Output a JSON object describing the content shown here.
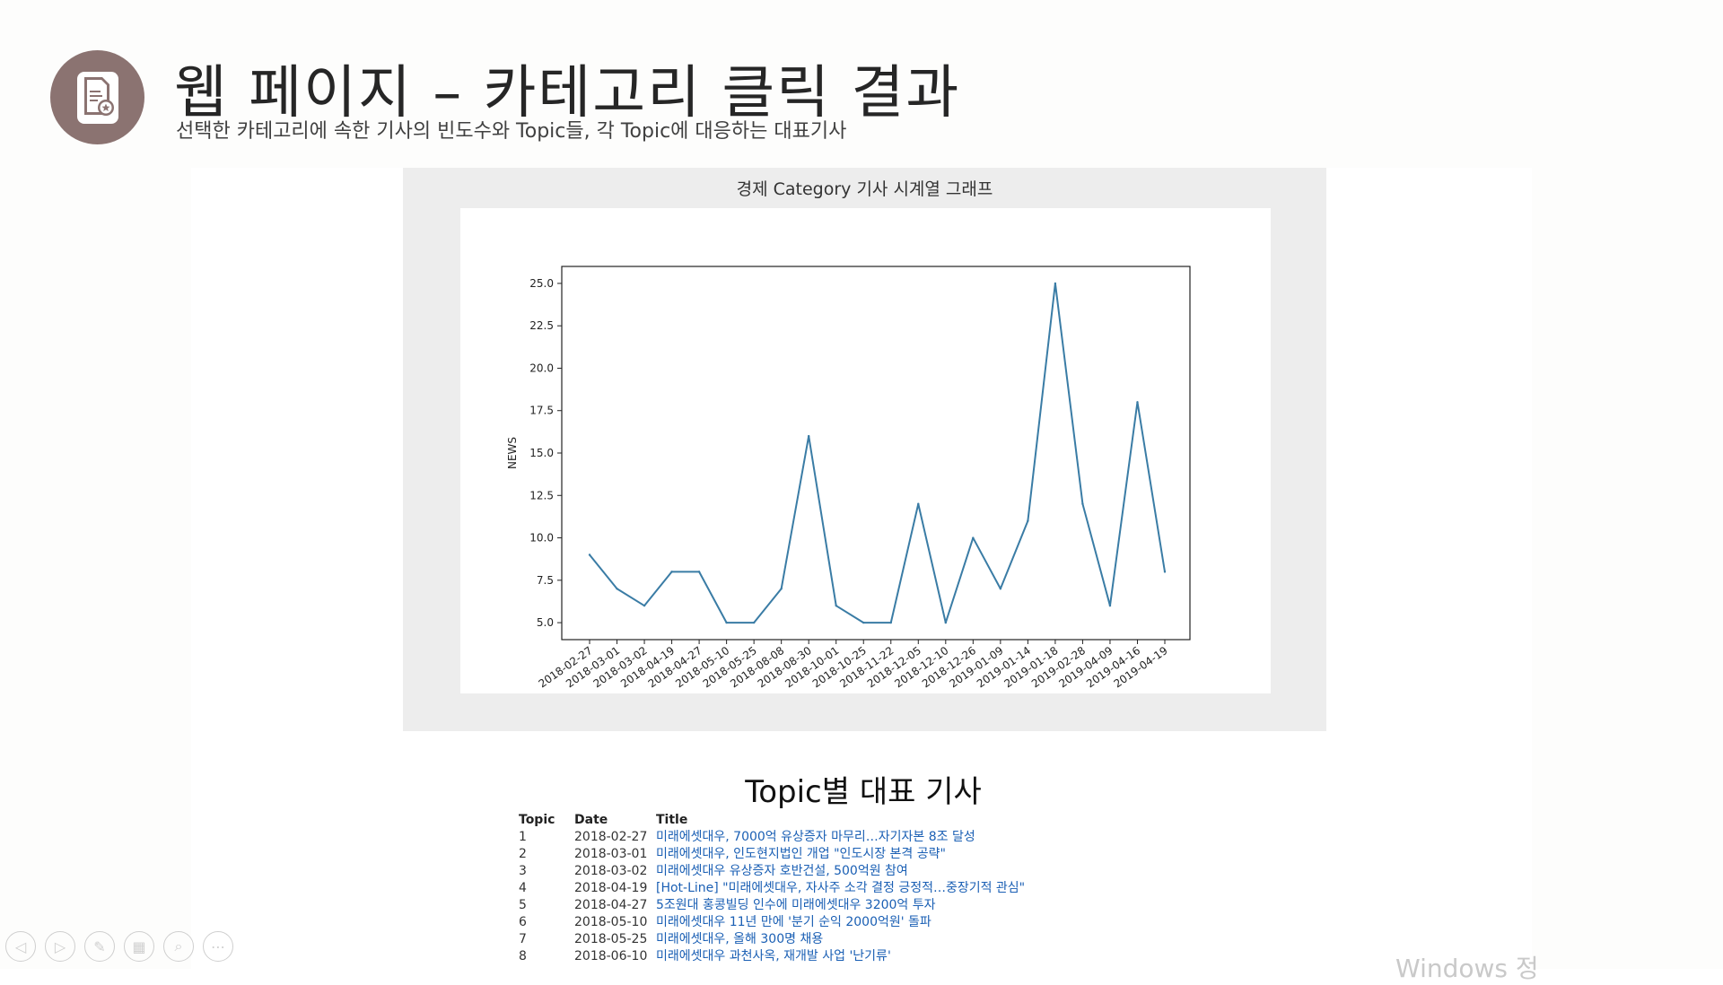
{
  "slide": {
    "title": "웹 페이지 – 카테고리 클릭 결과",
    "subtitle": "선택한 카테고리에 속한 기사의 빈도수와 Topic들, 각 Topic에 대응하는 대표기사"
  },
  "chart_title": "경제 Category 기사 시계열 그래프",
  "chart_data": {
    "type": "line",
    "title": "경제 Category 기사 시계열 그래프",
    "xlabel": "",
    "ylabel": "NEWS",
    "x": [
      "2018-02-27",
      "2018-03-01",
      "2018-03-02",
      "2018-04-19",
      "2018-04-27",
      "2018-05-10",
      "2018-05-25",
      "2018-08-08",
      "2018-08-30",
      "2018-10-01",
      "2018-10-25",
      "2018-11-22",
      "2018-12-05",
      "2018-12-10",
      "2018-12-26",
      "2019-01-09",
      "2019-01-14",
      "2019-01-18",
      "2019-02-28",
      "2019-04-09",
      "2019-04-16",
      "2019-04-19"
    ],
    "values": [
      9,
      7,
      6,
      8,
      8,
      5,
      5,
      7,
      16,
      6,
      5,
      5,
      12,
      5,
      10,
      7,
      11,
      25,
      12,
      6,
      18,
      8
    ],
    "y_ticks": [
      "5.0",
      "7.5",
      "10.0",
      "12.5",
      "15.0",
      "17.5",
      "20.0",
      "22.5",
      "25.0"
    ],
    "ylim": [
      4.0,
      26.0
    ],
    "grid": false,
    "color": "#3a7ca5"
  },
  "topics": {
    "heading": "Topic별 대표 기사",
    "columns": [
      "Topic",
      "Date",
      "Title"
    ],
    "rows": [
      {
        "topic": "1",
        "date": "2018-02-27",
        "title": "미래에셋대우, 7000억 유상증자 마무리…자기자본 8조 달성"
      },
      {
        "topic": "2",
        "date": "2018-03-01",
        "title": "미래에셋대우, 인도현지법인 개업 \"인도시장 본격 공략\""
      },
      {
        "topic": "3",
        "date": "2018-03-02",
        "title": "미래에셋대우 유상증자 호반건설, 500억원 참여"
      },
      {
        "topic": "4",
        "date": "2018-04-19",
        "title": "[Hot-Line] \"미래에셋대우, 자사주 소각 결정 긍정적…중장기적 관심\""
      },
      {
        "topic": "5",
        "date": "2018-04-27",
        "title": "5조원대 홍콩빌딩 인수에 미래에셋대우 3200억 투자"
      },
      {
        "topic": "6",
        "date": "2018-05-10",
        "title": "미래에셋대우 11년 만에 '분기 순익 2000억원' 돌파"
      },
      {
        "topic": "7",
        "date": "2018-05-25",
        "title": "미래에셋대우, 올해 300명 채용"
      },
      {
        "topic": "8",
        "date": "2018-06-10",
        "title": "미래에셋대우 과천사옥, 재개발 사업 '난기류'"
      }
    ]
  },
  "watermark": "Windows 정"
}
